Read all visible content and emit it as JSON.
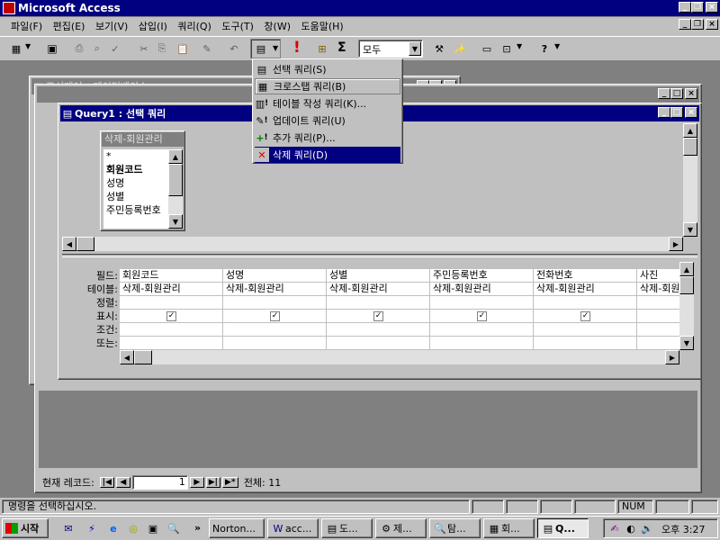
{
  "app": {
    "title": "Microsoft Access"
  },
  "menubar": [
    {
      "label": "파일(F)"
    },
    {
      "label": "편집(E)"
    },
    {
      "label": "보기(V)"
    },
    {
      "label": "삽입(I)"
    },
    {
      "label": "쿼리(Q)"
    },
    {
      "label": "도구(T)"
    },
    {
      "label": "창(W)"
    },
    {
      "label": "도움말(H)"
    }
  ],
  "toolbar": {
    "view_combo": "모두",
    "sigma": "Σ",
    "run": "!"
  },
  "query_type_menu": {
    "items": [
      {
        "label": "선택 쿼리(S)",
        "icon": "select-query-icon"
      },
      {
        "label": "크로스탭 쿼리(B)",
        "icon": "crosstab-query-icon"
      },
      {
        "label": "테이블 작성 쿼리(K)...",
        "icon": "make-table-query-icon"
      },
      {
        "label": "업데이트 쿼리(U)",
        "icon": "update-query-icon"
      },
      {
        "label": "추가 쿼리(P)...",
        "icon": "append-query-icon"
      },
      {
        "label": "삭제 쿼리(D)",
        "icon": "delete-query-icon"
      }
    ],
    "selected_index": 5
  },
  "database_window": {
    "title": "도서대여 : 데이터베이스"
  },
  "query_window": {
    "title": "Query1 : 선택 쿼리",
    "field_list": {
      "title": "삭제-회원관리",
      "fields": [
        "*",
        "회원코드",
        "성명",
        "성별",
        "주민등록번호"
      ]
    },
    "grid": {
      "row_labels": [
        "필드:",
        "테이블:",
        "정렬:",
        "표시:",
        "조건:",
        "또는:"
      ],
      "columns": [
        {
          "field": "회원코드",
          "table": "삭제-회원관리",
          "show": true
        },
        {
          "field": "성명",
          "table": "삭제-회원관리",
          "show": true
        },
        {
          "field": "성별",
          "table": "삭제-회원관리",
          "show": true
        },
        {
          "field": "주민등록번호",
          "table": "삭제-회원관리",
          "show": true
        },
        {
          "field": "전화번호",
          "table": "삭제-회원관리",
          "show": true
        },
        {
          "field": "사진",
          "table": "삭제-회원",
          "show": true
        }
      ]
    }
  },
  "record_nav": {
    "label": "현재 레코드:",
    "current": "1",
    "total_label": "전체: 11"
  },
  "statusbar": {
    "message": "명령을 선택하십시오.",
    "num": "NUM"
  },
  "taskbar": {
    "start": "시작",
    "tasks": [
      {
        "label": "Norton..."
      },
      {
        "label": "acc..."
      },
      {
        "label": "도..."
      },
      {
        "label": "제..."
      },
      {
        "label": "탐..."
      },
      {
        "label": "회..."
      },
      {
        "label": "Q..."
      }
    ],
    "clock": "오후 3:27",
    "overflow": "»"
  }
}
